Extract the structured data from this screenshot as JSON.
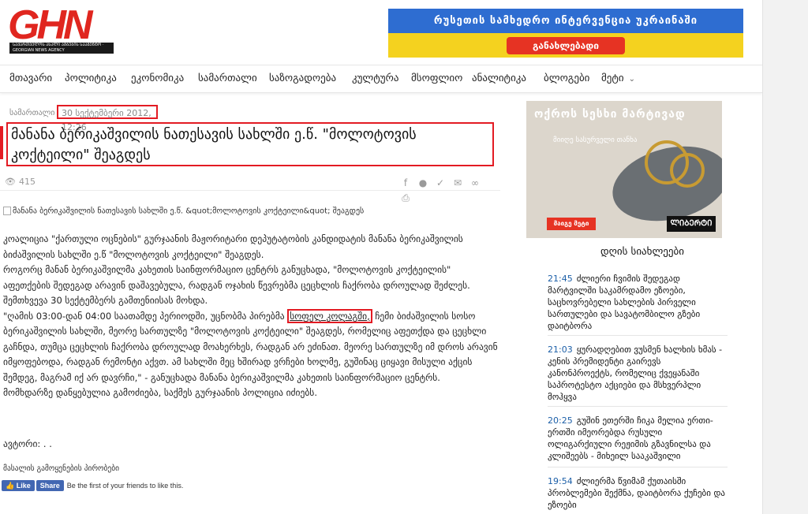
{
  "logo": {
    "text": "GHN",
    "tagline": "ᲡᲐᲥᲐᲠᲗᲕᲔᲚᲝᲡ ᲐᲮᲐᲚᲘ ᲐᲛᲑᲔᲑᲘᲡ ᲡᲐᲐᲒᲔᲜᲢᲝ · GEORGIAN NEWS AGENCY"
  },
  "banner": {
    "title": "რუსეთის სამხედრო ინტერვენცია უკრაინაში",
    "button": "განახლებადი",
    "colors": {
      "top": "#2e6dd1",
      "bottom": "#f4d21f",
      "button": "#e63323"
    }
  },
  "nav": {
    "items": [
      "მთავარი",
      "პოლიტიკა",
      "ეკონომიკა",
      "სამართალი",
      "საზოგადოება",
      "კულტურა",
      "მსოფლიო",
      "ანალიტიკა",
      "ბლოგები",
      "მეტი"
    ]
  },
  "article": {
    "category": "სამართალი",
    "date": "30 სექტემბერი 2012, 12:26",
    "title": "მანანა ბერიკაშვილის ნათესავის სახლში ე.წ. \"მოლოტოვის კოქტეილი\" შეაგდეს",
    "views": "415",
    "share_icons": [
      "facebook-icon",
      "messenger-icon",
      "twitter-icon",
      "mail-icon",
      "link-icon",
      "print-icon"
    ],
    "image_alt": "მანანა ბერიკაშვილის ნათესავის სახლში ე.წ. &quot;მოლოტოვის კოქტეილი&quot; შეაგდეს",
    "lead": "კოალიცია \"ქართული ოცნების\" გურჯაანის მაჟორიტარი დეპუტატობის კანდიდატის მანანა ბერიკაშვილის ბიძაშვილის სახლში ე.წ \"მოლოტოვის კოქტეილი\" შეაგდეს.",
    "p1": "როგორც მანან ბერიკაშვილმა კახეთის საინფორმაციო ცენტრს განუცხადა, \"მოლოტოვის კოქტეილის\" აფეთქების შედეგად არავინ დაშავებულა, რადგან ოჯახის წევრებმა ცეცხლის ჩაქრობა დროულად შეძლეს. შემთხვევა 30 სექტემბერს გამთენიისას მოხდა.",
    "p2_before": "\"ღამის 03:00-დან 04:00 საათამდე პერიოდში, უცნობმა პირებმა ",
    "p2_link": "სოფელ კოლაგში,",
    "p2_after": " ჩემი ბიძაშვილის სოსო ბერიკაშვილის სახლში, მეორე სართულზე \"მოლოტოვის კოქტეილი\" შეაგდეს, რომელიც აფეთქდა და ცეცხლი გაჩნდა, თუმცა ცეცხლის ჩაქრობა დროულად მოახერხეს, რადგან არ ეძინათ. მეორე სართულზე იმ დროს არავინ იმყოფებოდა, რადგან რემონტი აქვთ. ამ სახლში მეც ხშირად ვრჩები ხოლმე, გუშინაც ციყავი მისული აქცის შემდეგ, მაგრამ იქ არ დავრჩი,\" - განუცხადა მანანა ბერიკაშვილმა კახეთის საინფორმაციო ცენტრს.",
    "p3": "მომხდარზე დანყებულია გამოძიება, საქმეს გურჯაანის პოლიცია იძიებს.",
    "author": "ავტორი: . .",
    "tags": "მასალის გამოყენების პირობები",
    "fb_like": "Like",
    "fb_share": "Share",
    "fb_text": "Be the first of your friends to like this."
  },
  "ad": {
    "headline": "ოქროს სესხი მარტივად",
    "sub": "მიიღე სასურველი თანხა",
    "button": "მაიგე მეტი",
    "brand": "ᲚᲘᲑᲔᲠᲢᲘ"
  },
  "news": {
    "heading": "დღის სიახლეები",
    "items": [
      {
        "time": "21:45",
        "text": "ძლიერი ჩვიმის შედეგად მარტვილში საკამრდამო ეზოები, საცხოვრებელი სახლების პირველი სართულები და სავატომბილო გზები დაიტბორა"
      },
      {
        "time": "21:03",
        "text": "ყურადღებით ვუსმენ ხალხის ხმას - კენის პრემიდენტი გაირევს კანონპროექტს, რომელიც ქვეყანაში საპროტესტო აქციები და მსხვერპლი მოჰყვა"
      },
      {
        "time": "20:25",
        "text": "გუშინ ეთერში ჩიკა მელია ერთი-ერთში იმეორებდა რუსული ოლიგარქიული რეჟიმის გზავნილსა და კლიშეებს - მიხეილ სააკაშვილი"
      },
      {
        "time": "19:54",
        "text": "ძლიერმა წვიმამ ქუთაისში პრობლემები შექმნა, დაიტბორა ქუჩები და ეზოები"
      }
    ]
  }
}
